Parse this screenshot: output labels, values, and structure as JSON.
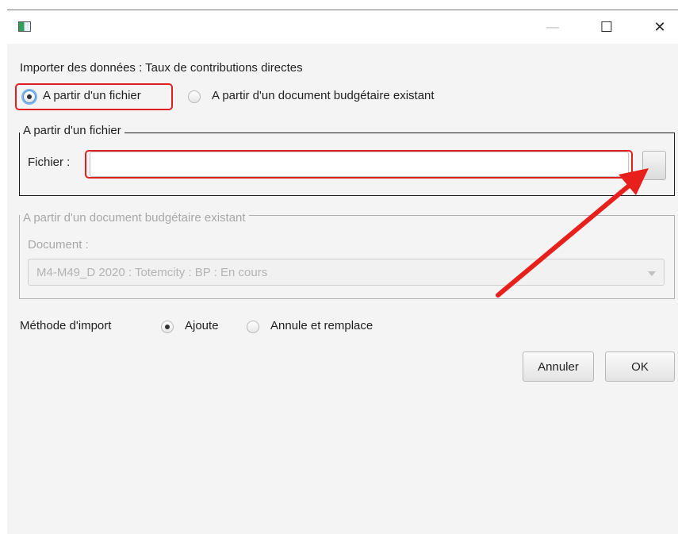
{
  "window": {
    "title": "",
    "controls": {
      "minimize": "—",
      "maximize": "☐",
      "close": "✕"
    }
  },
  "dialog": {
    "heading": "Importer des données : Taux de contributions directes",
    "source_options": [
      {
        "label": "A partir d'un fichier",
        "selected": true
      },
      {
        "label": "A partir d'un document budgétaire existant",
        "selected": false
      }
    ],
    "file_section": {
      "legend": "A partir d'un fichier",
      "field_label": "Fichier :",
      "field_value": ""
    },
    "document_section": {
      "legend": "A partir d'un document budgétaire existant",
      "field_label": "Document :",
      "selected_document": "M4-M49_D 2020 : Totemcity : BP : En cours",
      "enabled": false
    },
    "import_method": {
      "label": "Méthode d'import",
      "options": [
        {
          "label": "Ajoute",
          "selected": true
        },
        {
          "label": "Annule et remplace",
          "selected": false
        }
      ]
    },
    "buttons": {
      "cancel": "Annuler",
      "ok": "OK"
    }
  },
  "annotations": {
    "highlight_color": "#e02020",
    "arrow_color": "#e8201c",
    "highlighted_items": [
      "radio-from-file",
      "file-input"
    ],
    "arrow_points_to": "browse-button"
  }
}
